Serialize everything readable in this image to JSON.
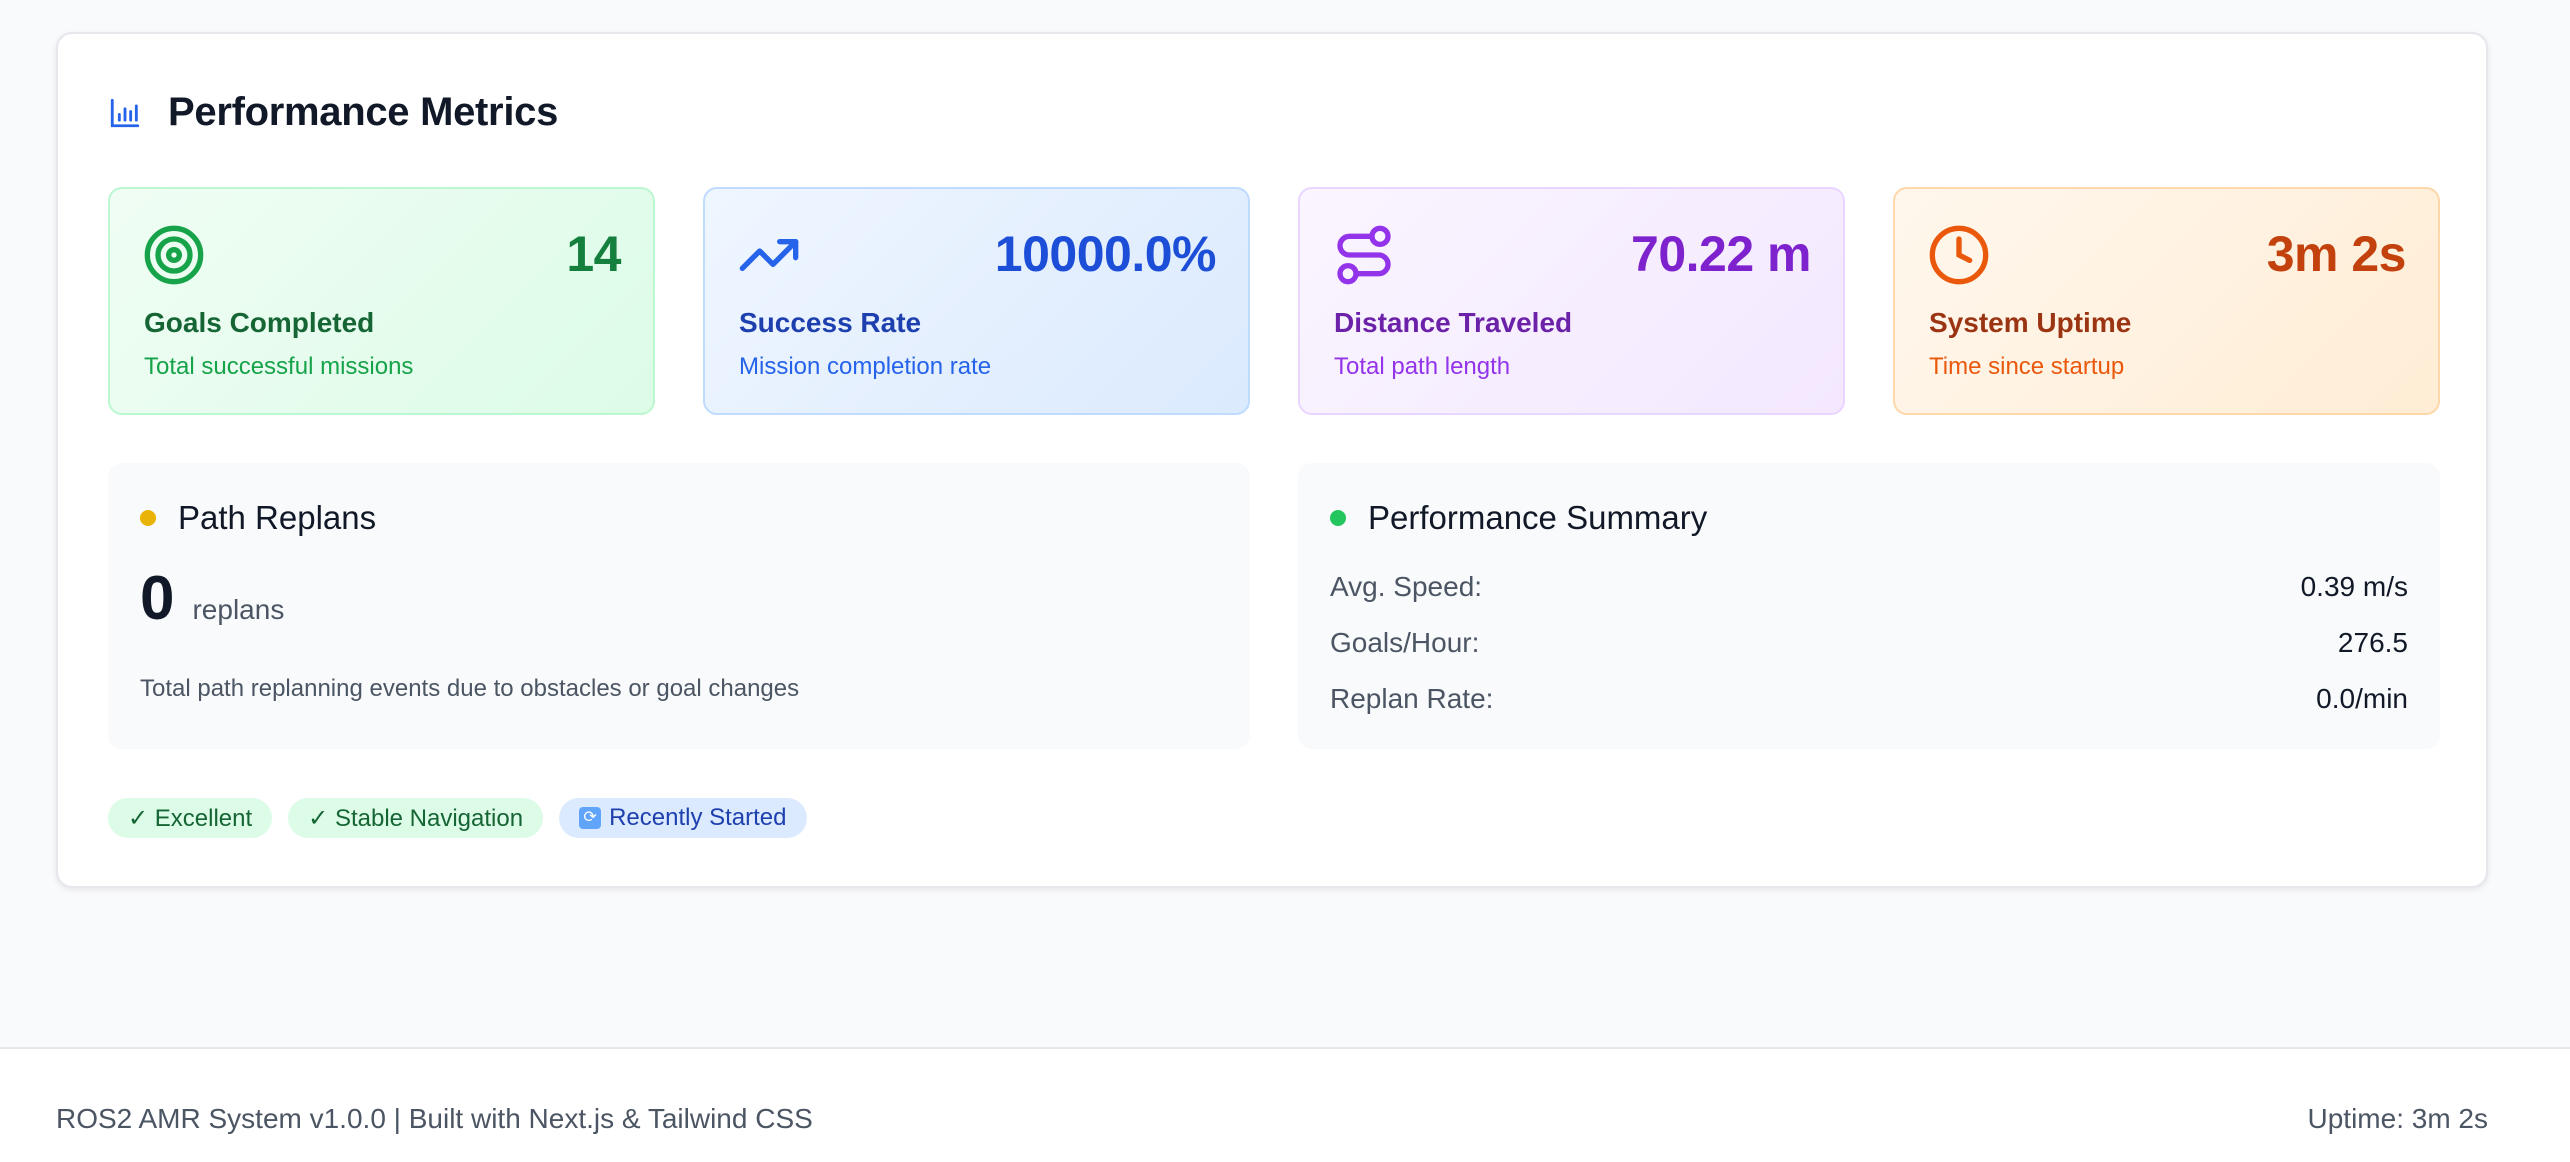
{
  "header": {
    "title": "Performance Metrics",
    "icon": "bar-chart-icon"
  },
  "metrics": [
    {
      "value": "14",
      "label": "Goals Completed",
      "sub": "Total successful missions",
      "icon": "target-icon",
      "color": "#15803d"
    },
    {
      "value": "10000.0%",
      "label": "Success Rate",
      "sub": "Mission completion rate",
      "icon": "trending-up-icon",
      "color": "#1d4ed8"
    },
    {
      "value": "70.22 m",
      "label": "Distance Traveled",
      "sub": "Total path length",
      "icon": "route-icon",
      "color": "#7e22ce"
    },
    {
      "value": "3m 2s",
      "label": "System Uptime",
      "sub": "Time since startup",
      "icon": "clock-icon",
      "color": "#c2410c"
    }
  ],
  "replans": {
    "title": "Path Replans",
    "count": "0",
    "unit": "replans",
    "description": "Total path replanning events due to obstacles or goal changes",
    "dot_color": "#eab308"
  },
  "summary": {
    "title": "Performance Summary",
    "dot_color": "#22c55e",
    "rows": [
      {
        "label": "Avg. Speed:",
        "value": "0.39 m/s"
      },
      {
        "label": "Goals/Hour:",
        "value": "276.5"
      },
      {
        "label": "Replan Rate:",
        "value": "0.0/min"
      }
    ]
  },
  "badges": [
    {
      "label": "✓ Excellent"
    },
    {
      "label": "✓ Stable Navigation"
    },
    {
      "label": "Recently Started",
      "icon": "refresh-icon"
    }
  ],
  "footer": {
    "left": "ROS2 AMR System v1.0.0 | Built with Next.js & Tailwind CSS",
    "right": "Uptime: 3m 2s"
  }
}
